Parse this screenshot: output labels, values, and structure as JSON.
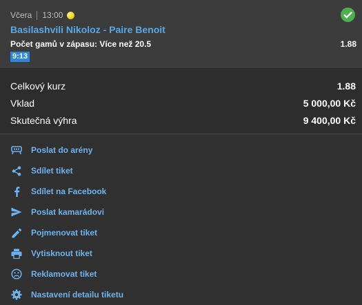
{
  "ticket": {
    "day": "Včera",
    "time": "13:00",
    "match": "Basilashvili Nikoloz - Paire Benoit",
    "bet_label": "Počet gamů v zápasu: Více než 20.5",
    "odds": "1.88",
    "score": "9:13",
    "status_icon": "check-icon",
    "sport_icon": "tennis-ball-icon"
  },
  "summary": {
    "total_odds_label": "Celkový kurz",
    "total_odds_value": "1.88",
    "stake_label": "Vklad",
    "stake_value": "5 000,00 Kč",
    "win_label": "Skutečná výhra",
    "win_value": "9 400,00 Kč"
  },
  "actions": [
    {
      "label": "Poslat do arény",
      "icon": "arena-icon"
    },
    {
      "label": "Sdílet tiket",
      "icon": "share-icon"
    },
    {
      "label": "Sdílet na Facebook",
      "icon": "facebook-icon"
    },
    {
      "label": "Poslat kamarádovi",
      "icon": "send-icon"
    },
    {
      "label": "Pojmenovat tiket",
      "icon": "pencil-icon"
    },
    {
      "label": "Vytisknout tiket",
      "icon": "printer-icon"
    },
    {
      "label": "Reklamovat tiket",
      "icon": "sad-face-icon"
    },
    {
      "label": "Nastavení detailu tiketu",
      "icon": "gear-icon"
    }
  ],
  "colors": {
    "link": "#57a8ea",
    "success": "#4caf50",
    "badge": "#2f86d6"
  }
}
